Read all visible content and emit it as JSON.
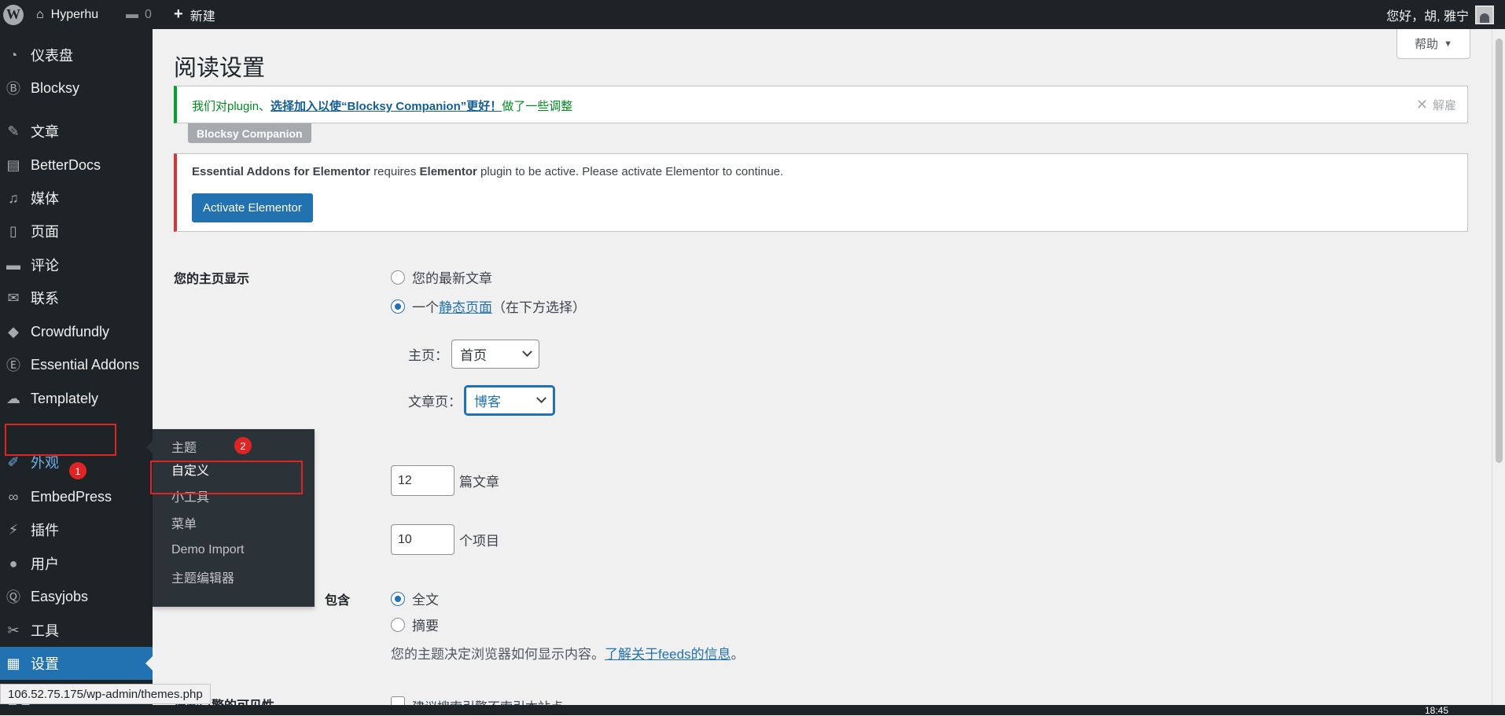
{
  "adminbar": {
    "site_name": "Hyperhu",
    "comments_count": "0",
    "new_label": "新建",
    "greeting": "您好，胡, 雅宁"
  },
  "sidebar": {
    "items": [
      {
        "label": "仪表盘",
        "icon": "dashboard-icon",
        "glyph": "◔"
      },
      {
        "label": "Blocksy",
        "icon": "blocksy-icon",
        "glyph": "Ⓑ"
      },
      {
        "label": "文章",
        "icon": "pin-icon",
        "glyph": "✎"
      },
      {
        "label": "BetterDocs",
        "icon": "docs-icon",
        "glyph": "▤"
      },
      {
        "label": "媒体",
        "icon": "media-icon",
        "glyph": "♫"
      },
      {
        "label": "页面",
        "icon": "page-icon",
        "glyph": "▯"
      },
      {
        "label": "评论",
        "icon": "comment-icon",
        "glyph": "▬"
      },
      {
        "label": "联系",
        "icon": "mail-icon",
        "glyph": "✉"
      },
      {
        "label": "Crowdfundly",
        "icon": "crowdfundly-icon",
        "glyph": "◆"
      },
      {
        "label": "Essential Addons",
        "icon": "ea-icon",
        "glyph": "Ⓔ"
      },
      {
        "label": "Templately",
        "icon": "templately-icon",
        "glyph": "☁"
      },
      {
        "label": "外观",
        "icon": "appearance-icon",
        "glyph": "✐"
      },
      {
        "label": "EmbedPress",
        "icon": "embedpress-icon",
        "glyph": "∞"
      },
      {
        "label": "插件",
        "icon": "plugin-icon",
        "glyph": "⚡"
      },
      {
        "label": "用户",
        "icon": "user-icon",
        "glyph": "●"
      },
      {
        "label": "Easyjobs",
        "icon": "easyjobs-icon",
        "glyph": "Ⓠ"
      },
      {
        "label": "工具",
        "icon": "tools-icon",
        "glyph": "✂"
      },
      {
        "label": "设置",
        "icon": "settings-icon",
        "glyph": "▦"
      }
    ],
    "partial_label": "管理"
  },
  "flyout": {
    "items": [
      "主题",
      "自定义",
      "小工具",
      "菜单",
      "Demo Import",
      "主题编辑器"
    ]
  },
  "annotations": {
    "badge1": "1",
    "badge2": "2"
  },
  "help_label": "帮助",
  "page_title": "阅读设置",
  "notice_success": {
    "prefix": "我们对plugin、",
    "link": "选择加入以使“Blocksy Companion”更好！",
    "suffix": "做了一些调整",
    "dismiss": "解雇",
    "tag": "Blocksy Companion"
  },
  "notice_error": {
    "strong1": "Essential Addons for Elementor",
    "text1": " requires ",
    "strong2": "Elementor",
    "text2": " plugin to be active. Please activate Elementor to continue.",
    "button": "Activate Elementor"
  },
  "homepage_display": {
    "label": "您的主页显示",
    "option_latest": "您的最新文章",
    "option_static_prefix": "一个",
    "option_static_link": "静态页面",
    "option_static_suffix": "（在下方选择）",
    "selected": "static"
  },
  "front_page": {
    "label": "主页：",
    "value": "首页"
  },
  "posts_page": {
    "label": "文章页：",
    "value": "博客"
  },
  "posts_per_page": {
    "value": "12",
    "suffix": "篇文章"
  },
  "feed_items": {
    "value": "10",
    "suffix": "个项目"
  },
  "feed_content": {
    "label_partial": "包含",
    "option_full": "全文",
    "option_summary": "摘要",
    "selected": "full",
    "desc_prefix": "您的主题决定浏览器如何显示内容。",
    "desc_link": "了解关于feeds的信息",
    "desc_suffix": "。"
  },
  "search_visibility": {
    "label_partial": "搜索引擎的可见性",
    "checkbox_label": "建议搜索引擎不索引本站点"
  },
  "status_url": "106.52.75.175/wp-admin/themes.php",
  "taskbar_clock": "18:45",
  "colors": {
    "accent": "#2271b1",
    "admin_dark": "#1d2327",
    "annotation_red": "#e02424",
    "success": "#00a32a",
    "error": "#d63638"
  }
}
